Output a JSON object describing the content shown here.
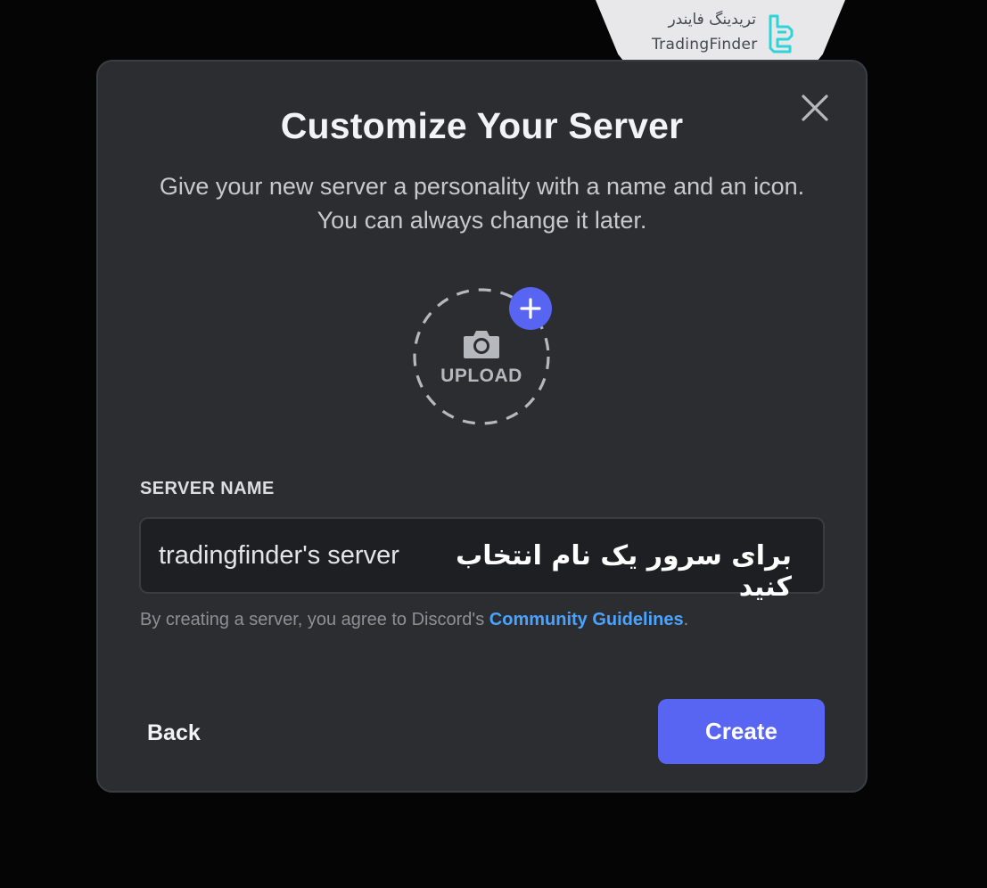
{
  "watermark": {
    "brand_fa": "تریدینگ فایندر",
    "brand_en": "TradingFinder",
    "logo_icon": "tradingfinder-logo-icon"
  },
  "modal": {
    "title": "Customize Your Server",
    "subtitle": "Give your new server a personality with a name and an icon. You can always change it later.",
    "close_icon": "close-icon",
    "upload": {
      "label": "UPLOAD",
      "icon": "camera-icon",
      "badge_icon": "plus-icon"
    },
    "server_name": {
      "label": "SERVER NAME",
      "value": "tradingfinder's server"
    },
    "annotation_fa": "برای سرور یک نام انتخاب کنید",
    "legal": {
      "prefix": "By creating a server, you agree to Discord's ",
      "link": "Community Guidelines",
      "suffix": "."
    },
    "back_label": "Back",
    "create_label": "Create"
  },
  "colors": {
    "background": "#050505",
    "modal": "#2b2d31",
    "accent": "#5865f2",
    "link": "#4aa3ff",
    "brand": "#2fd3d8"
  }
}
